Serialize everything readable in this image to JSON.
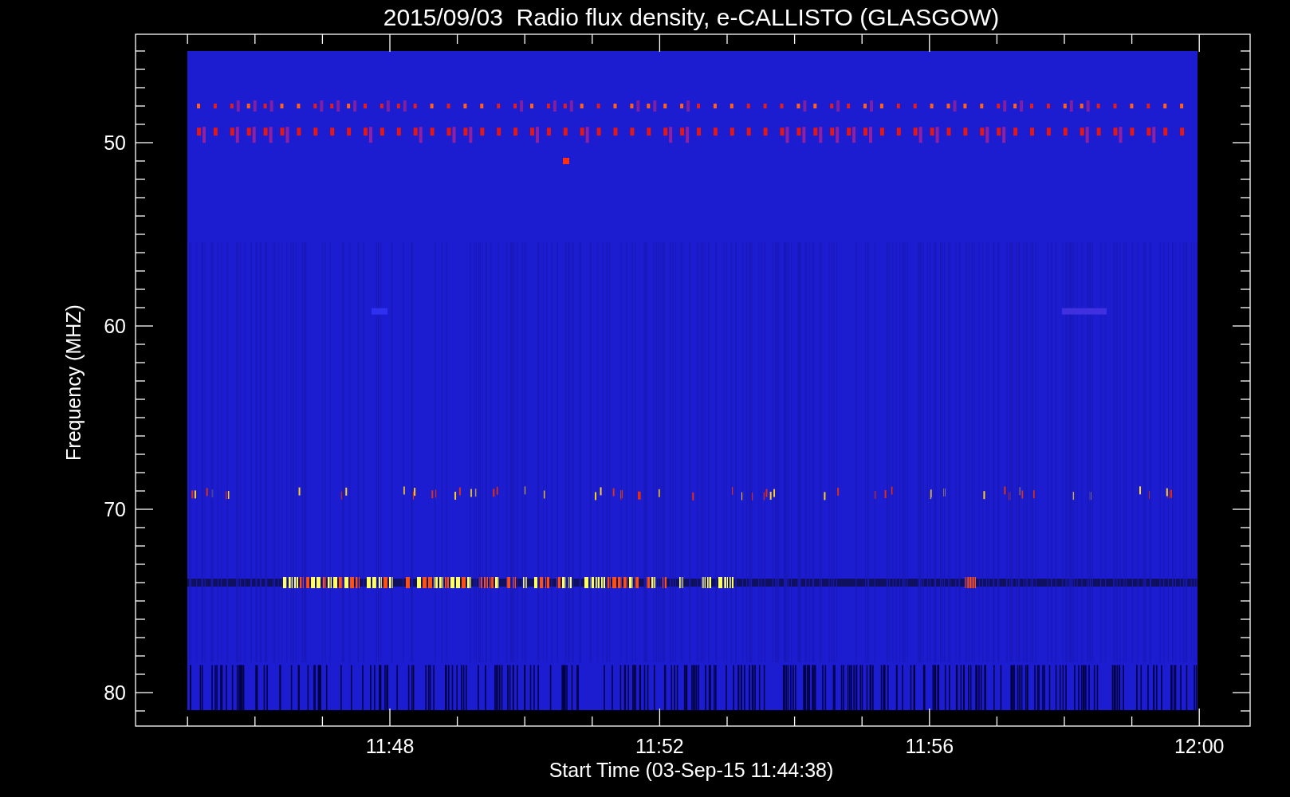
{
  "title": "2015/09/03  Radio flux density, e-CALLISTO (GLASGOW)",
  "plot": {
    "ylabel": "Frequency (MHZ)",
    "xlabel": "Start Time (03-Sep-15 11:44:38)",
    "yticks": [
      "50",
      "60",
      "70",
      "80"
    ],
    "xticks": [
      "11:48",
      "11:52",
      "11:56",
      "12:00"
    ]
  }
}
